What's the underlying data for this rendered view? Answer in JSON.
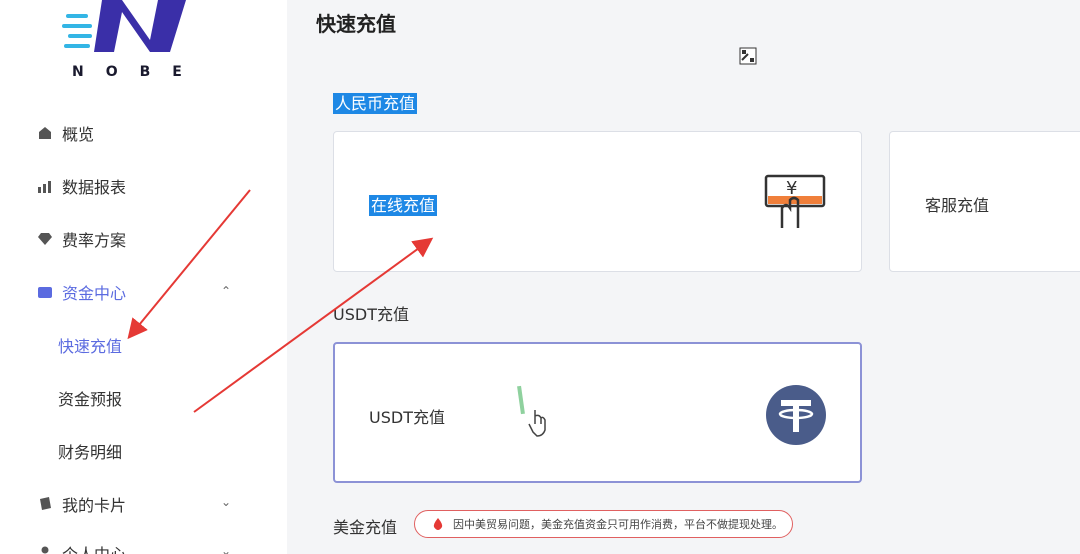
{
  "brand": {
    "name": "NOBE"
  },
  "sidebar": {
    "items": [
      {
        "label": "概览",
        "icon": "home-icon"
      },
      {
        "label": "数据报表",
        "icon": "chart-icon"
      },
      {
        "label": "费率方案",
        "icon": "diamond-icon"
      },
      {
        "label": "资金中心",
        "icon": "wallet-icon",
        "expanded": true
      },
      {
        "label": "我的卡片",
        "icon": "card-icon"
      },
      {
        "label": "个人中心",
        "icon": "user-icon"
      }
    ],
    "subitems": [
      {
        "label": "快速充值",
        "active": true
      },
      {
        "label": "资金预报"
      },
      {
        "label": "财务明细"
      }
    ]
  },
  "main": {
    "title": "快速充值",
    "sections": {
      "rmb": {
        "label": "人民币充值",
        "cards": {
          "online": "在线充值",
          "service": "客服充值"
        }
      },
      "usdt": {
        "label": "USDT充值",
        "card": "USDT充值"
      },
      "usd": {
        "label": "美金充值",
        "notice": "因中美贸易问题，美金充值资金只可用作消费，平台不做提现处理。"
      }
    }
  },
  "colors": {
    "accent": "#5b6be0",
    "highlight": "#1e88e5",
    "tether": "#4a5c8a",
    "arrow": "#e53935"
  }
}
